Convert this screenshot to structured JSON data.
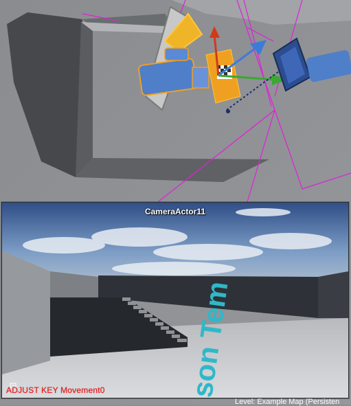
{
  "viewport": {
    "selected_actor": "CameraActor11",
    "gizmo_colors": {
      "x": "#3aa832",
      "y": "#3d7bd9",
      "z": "#d03a1a"
    },
    "selection_color": "#f0a020",
    "spline_color": "#e020d8"
  },
  "camera_preview": {
    "title": "CameraActor11",
    "floor_text": "son Tem",
    "floor_text_color": "#2fb8c8"
  },
  "status": {
    "icon": "key-icon",
    "message": "ADJUST KEY Movement0",
    "message_color": "#ff1010"
  },
  "level": {
    "label": "Level:  Example Map (Persisten"
  }
}
